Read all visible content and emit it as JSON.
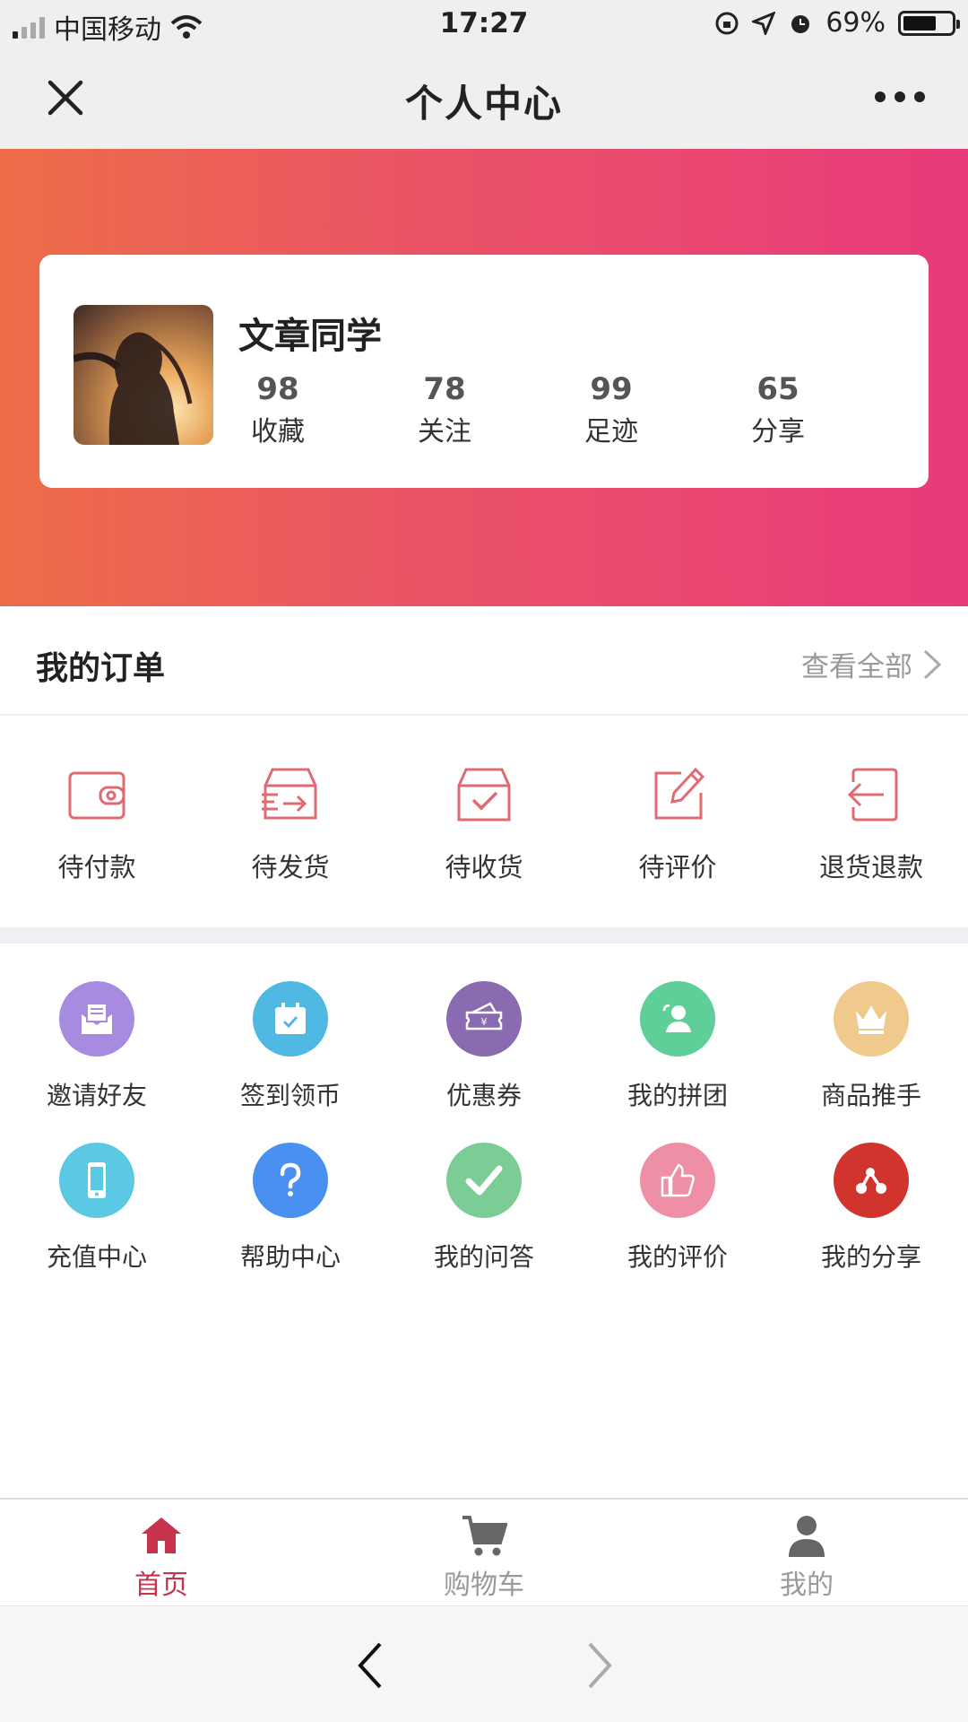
{
  "status_bar": {
    "carrier": "中国移动",
    "time": "17:27",
    "battery": "69%",
    "battery_level": 0.69
  },
  "navbar": {
    "title": "个人中心"
  },
  "profile": {
    "username": "文章同学",
    "stats": [
      {
        "num": "98",
        "label": "收藏"
      },
      {
        "num": "78",
        "label": "关注"
      },
      {
        "num": "99",
        "label": "足迹"
      },
      {
        "num": "65",
        "label": "分享"
      }
    ]
  },
  "orders": {
    "heading": "我的订单",
    "view_all": "查看全部",
    "items": [
      {
        "label": "待付款",
        "icon": "wallet-icon"
      },
      {
        "label": "待发货",
        "icon": "ship-box-icon"
      },
      {
        "label": "待收货",
        "icon": "receive-box-icon"
      },
      {
        "label": "待评价",
        "icon": "edit-icon"
      },
      {
        "label": "退货退款",
        "icon": "return-icon"
      }
    ]
  },
  "services": [
    {
      "label": "邀请好友",
      "icon": "envelope-icon",
      "color": "#a68be0"
    },
    {
      "label": "签到领币",
      "icon": "calendar-check-icon",
      "color": "#4fb8e3"
    },
    {
      "label": "优惠券",
      "icon": "coupon-icon",
      "color": "#8a6ab0"
    },
    {
      "label": "我的拼团",
      "icon": "group-user-icon",
      "color": "#5fcf9a"
    },
    {
      "label": "商品推手",
      "icon": "crown-icon",
      "color": "#f0c98c"
    },
    {
      "label": "充值中心",
      "icon": "phone-icon",
      "color": "#5bc8e4"
    },
    {
      "label": "帮助中心",
      "icon": "question-icon",
      "color": "#4a90f0"
    },
    {
      "label": "我的问答",
      "icon": "check-icon",
      "color": "#7ccc96"
    },
    {
      "label": "我的评价",
      "icon": "thumb-up-icon",
      "color": "#ef8fa5"
    },
    {
      "label": "我的分享",
      "icon": "share-icon",
      "color": "#d0342c"
    }
  ],
  "tabbar": {
    "items": [
      {
        "label": "首页",
        "icon": "home-icon",
        "active": true
      },
      {
        "label": "购物车",
        "icon": "cart-icon",
        "active": false
      },
      {
        "label": "我的",
        "icon": "person-icon",
        "active": false
      }
    ],
    "active_color": "#c7334d"
  }
}
